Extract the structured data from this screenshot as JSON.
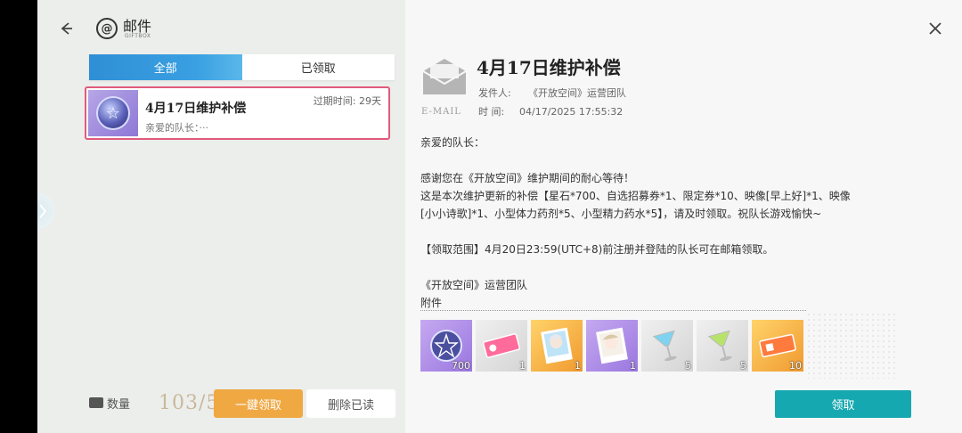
{
  "header": {
    "title": "邮件",
    "subtitle": "GIFTBOX"
  },
  "tabs": [
    {
      "label": "全部",
      "active": true
    },
    {
      "label": "已领取",
      "active": false
    }
  ],
  "mail_list": [
    {
      "title": "4月17日维护补偿",
      "preview": "亲爱的队长：···",
      "expire": "过期时间: 29天",
      "selected": true
    }
  ],
  "footer": {
    "count_label": "数量",
    "count_value": "103/50",
    "claim_all_label": "一鍵领取",
    "delete_read_label": "删除已读"
  },
  "detail": {
    "envelope_label": "E-MAIL",
    "title": "4月17日维护补偿",
    "sender_label": "发件人:",
    "sender_value": "《开放空间》运营团队",
    "time_label": "时  间:",
    "time_value": "04/17/2025 17:55:32",
    "body": {
      "greeting": "亲爱的队长：",
      "line1": "感谢您在《开放空间》维护期间的耐心等待！",
      "line2": "这是本次维护更新的补偿【星石*700、自选招募券*1、限定券*10、映像[早上好]*1、映像",
      "line3": "[小小诗歌]*1、小型体力药剂*5、小型精力药水*5】，请及时领取。祝队长游戏愉快~",
      "line4": "【领取范围】4月20日23:59(UTC+8)前注册并登陆的队长可在邮箱领取。",
      "signature": "《开放空间》运营团队"
    },
    "attachments_label": "附件",
    "attachments": [
      {
        "icon": "star-stone-icon",
        "qty": "700",
        "rarity": "purple"
      },
      {
        "icon": "recruit-ticket-icon",
        "qty": "1",
        "rarity": "gray"
      },
      {
        "icon": "portrait-morning-icon",
        "qty": "1",
        "rarity": "gold"
      },
      {
        "icon": "portrait-poem-icon",
        "qty": "1",
        "rarity": "purple"
      },
      {
        "icon": "stamina-potion-icon",
        "qty": "5",
        "rarity": "gray"
      },
      {
        "icon": "energy-potion-icon",
        "qty": "5",
        "rarity": "gray"
      },
      {
        "icon": "limited-ticket-icon",
        "qty": "10",
        "rarity": "gold"
      }
    ],
    "claim_label": "领取"
  },
  "colors": {
    "accent_blue": "#2f8fd6",
    "selected_border": "#e05a7c",
    "claim_all_orange": "#f0a843",
    "claim_teal": "#16a8b0"
  }
}
